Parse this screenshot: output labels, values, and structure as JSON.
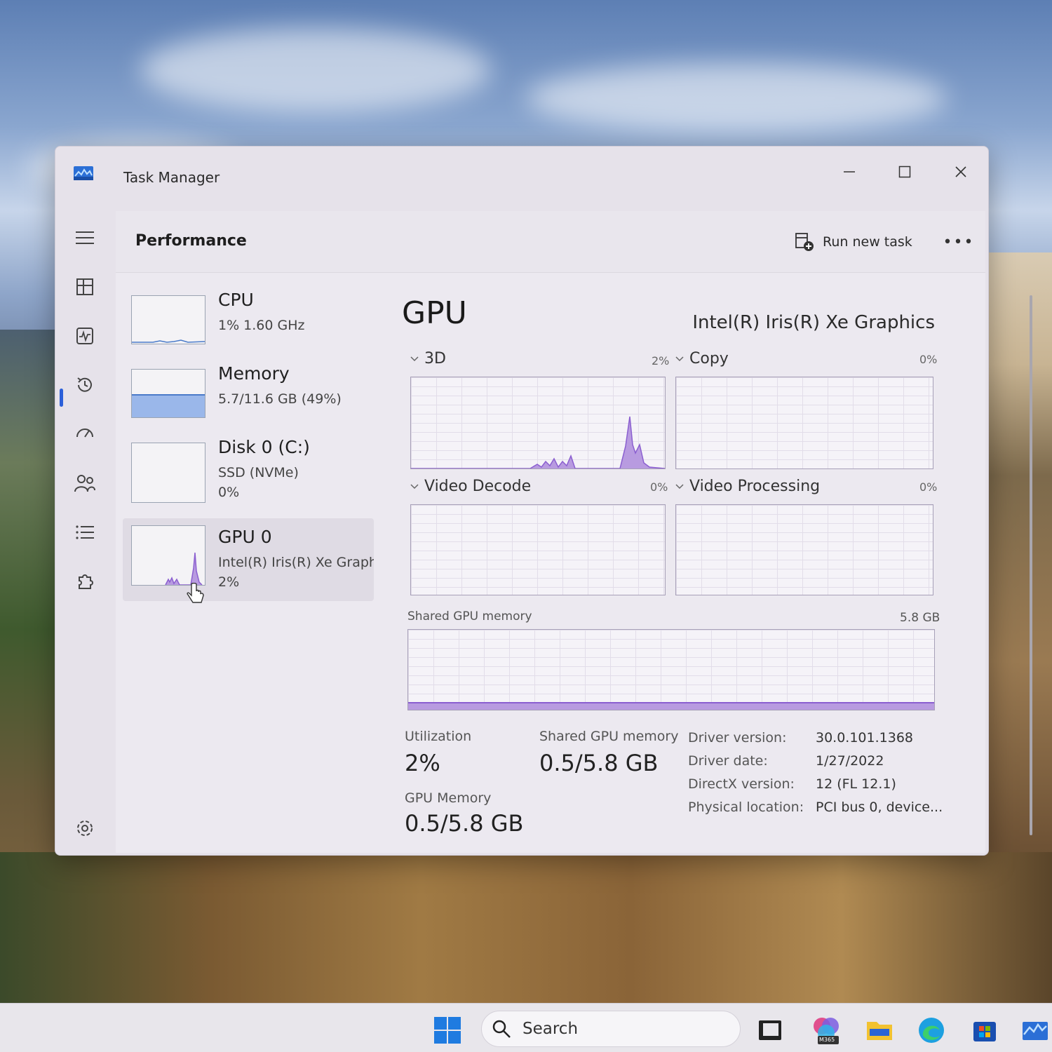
{
  "window": {
    "title": "Task Manager"
  },
  "header": {
    "title": "Performance",
    "run_task_label": "Run new task",
    "more_label": "•••"
  },
  "devices": [
    {
      "name": "CPU",
      "sub1": "1%  1.60 GHz",
      "sub2": ""
    },
    {
      "name": "Memory",
      "sub1": "5.7/11.6 GB (49%)",
      "sub2": ""
    },
    {
      "name": "Disk 0 (C:)",
      "sub1": "SSD (NVMe)",
      "sub2": "0%"
    },
    {
      "name": "GPU 0",
      "sub1": "Intel(R) Iris(R) Xe Graphi",
      "sub2": "2%"
    }
  ],
  "memory_usage": 0.49,
  "gpu": {
    "title": "GPU",
    "model": "Intel(R) Iris(R) Xe Graphics",
    "panels": [
      {
        "label": "3D",
        "value": "2%"
      },
      {
        "label": "Copy",
        "value": "0%"
      },
      {
        "label": "Video Decode",
        "value": "0%"
      },
      {
        "label": "Video Processing",
        "value": "0%"
      }
    ],
    "shared_memory": {
      "label": "Shared GPU memory",
      "max": "5.8 GB"
    }
  },
  "stats": {
    "utilization_label": "Utilization",
    "utilization_value": "2%",
    "shared_label": "Shared GPU memory",
    "shared_value": "0.5/5.8 GB",
    "gpu_memory_label": "GPU Memory",
    "gpu_memory_value": "0.5/5.8 GB"
  },
  "info": [
    {
      "key": "Driver version:",
      "value": "30.0.101.1368"
    },
    {
      "key": "Driver date:",
      "value": "1/27/2022"
    },
    {
      "key": "DirectX version:",
      "value": "12 (FL 12.1)"
    },
    {
      "key": "Physical location:",
      "value": "PCI bus 0, device..."
    }
  ],
  "taskbar": {
    "search_label": "Search",
    "m365_badge": "M365"
  },
  "colors": {
    "accent": "#2b5fd9",
    "graph_fill": "#b89be0",
    "graph_line": "#8b5fd0",
    "memory_fill": "#9ab7ea"
  }
}
